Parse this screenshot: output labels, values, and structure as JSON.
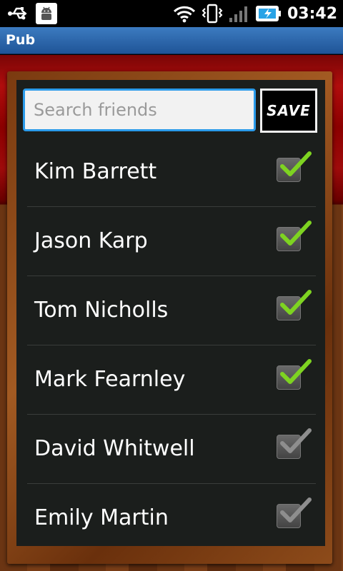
{
  "status_bar": {
    "time": "03:42",
    "icons": [
      "usb-icon",
      "android-debug-icon",
      "wifi-icon",
      "vibrate-icon",
      "signal-icon",
      "battery-charging-icon"
    ]
  },
  "app": {
    "title": "Pub"
  },
  "search": {
    "placeholder": "Search friends",
    "value": ""
  },
  "save_button": {
    "label": "SAVE"
  },
  "colors": {
    "checked": "#7ed321",
    "unchecked": "#8e8e8e",
    "accent": "#2b9bea"
  },
  "friends": [
    {
      "name": "Kim Barrett",
      "checked": true
    },
    {
      "name": "Jason Karp",
      "checked": true
    },
    {
      "name": "Tom Nicholls",
      "checked": true
    },
    {
      "name": "Mark Fearnley",
      "checked": true
    },
    {
      "name": "David Whitwell",
      "checked": false
    },
    {
      "name": "Emily Martin",
      "checked": false
    }
  ]
}
